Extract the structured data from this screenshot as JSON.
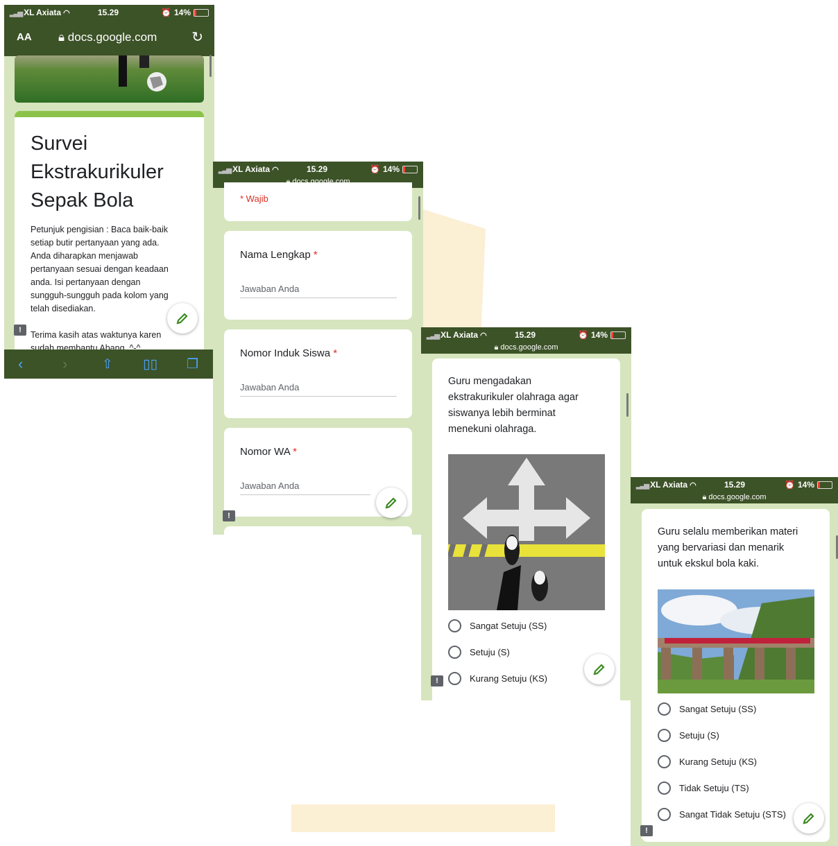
{
  "status": {
    "carrier": "XL Axiata",
    "time": "15.29",
    "battery": "14%"
  },
  "browser": {
    "text_size_button": "AA",
    "url": "docs.google.com"
  },
  "form": {
    "title": "Survei Ekstrakurikuler Sepak Bola",
    "title_lines": [
      "Survei",
      "Ekstrakurikuler",
      "Sepak Bola"
    ],
    "instructions": "Petunjuk pengisian : Baca baik-baik setiap butir pertanyaan yang ada. Anda diharapkan menjawab pertanyaan sesuai dengan keadaan anda. Isi pertanyaan dengan sungguh-sungguh pada kolom yang telah disediakan.",
    "instruction_lines": [
      "Petunjuk pengisian : Baca baik-baik",
      "setiap butir pertanyaan yang ada.",
      "Anda diharapkan menjawab",
      "pertanyaan sesuai dengan keadaan",
      "anda. Isi pertanyaan dengan",
      "sungguh-sungguh pada kolom yang",
      "telah disediakan."
    ],
    "thanks_lines": [
      "Terima kasih atas waktunya karen",
      "sudah membantu Abang. ^-^"
    ],
    "required_note": "* Wajib",
    "answer_placeholder": "Jawaban Anda",
    "fields": [
      {
        "label": "Nama Lengkap",
        "required": "*"
      },
      {
        "label": "Nomor Induk Siswa",
        "required": "*"
      },
      {
        "label": "Nomor WA",
        "required": "*"
      }
    ],
    "question3": {
      "lines": [
        "Guru mengadakan",
        "ekstrakurikuler olahraga agar",
        "siswanya lebih berminat",
        "menekuni olahraga."
      ],
      "options": [
        "Sangat Setuju (SS)",
        "Setuju (S)",
        "Kurang Setuju (KS)"
      ]
    },
    "question4": {
      "lines": [
        "Guru selalu memberikan materi",
        "yang bervariasi dan menarik",
        "untuk ekskul bola kaki."
      ],
      "options": [
        "Sangat Setuju (SS)",
        "Setuju (S)",
        "Kurang Setuju (KS)",
        "Tidak Setuju (TS)",
        "Sangat Tidak Setuju (STS)"
      ]
    }
  },
  "colors": {
    "form_background": "#d6e5bd",
    "header_accent": "#8bc34a",
    "browser_chrome": "#3c5227",
    "required_red": "#d93025"
  },
  "icons": [
    "lock-icon",
    "reload-icon",
    "edit-pencil-icon",
    "report-icon",
    "back-icon",
    "forward-icon",
    "share-icon",
    "bookmarks-icon",
    "tabs-icon"
  ]
}
